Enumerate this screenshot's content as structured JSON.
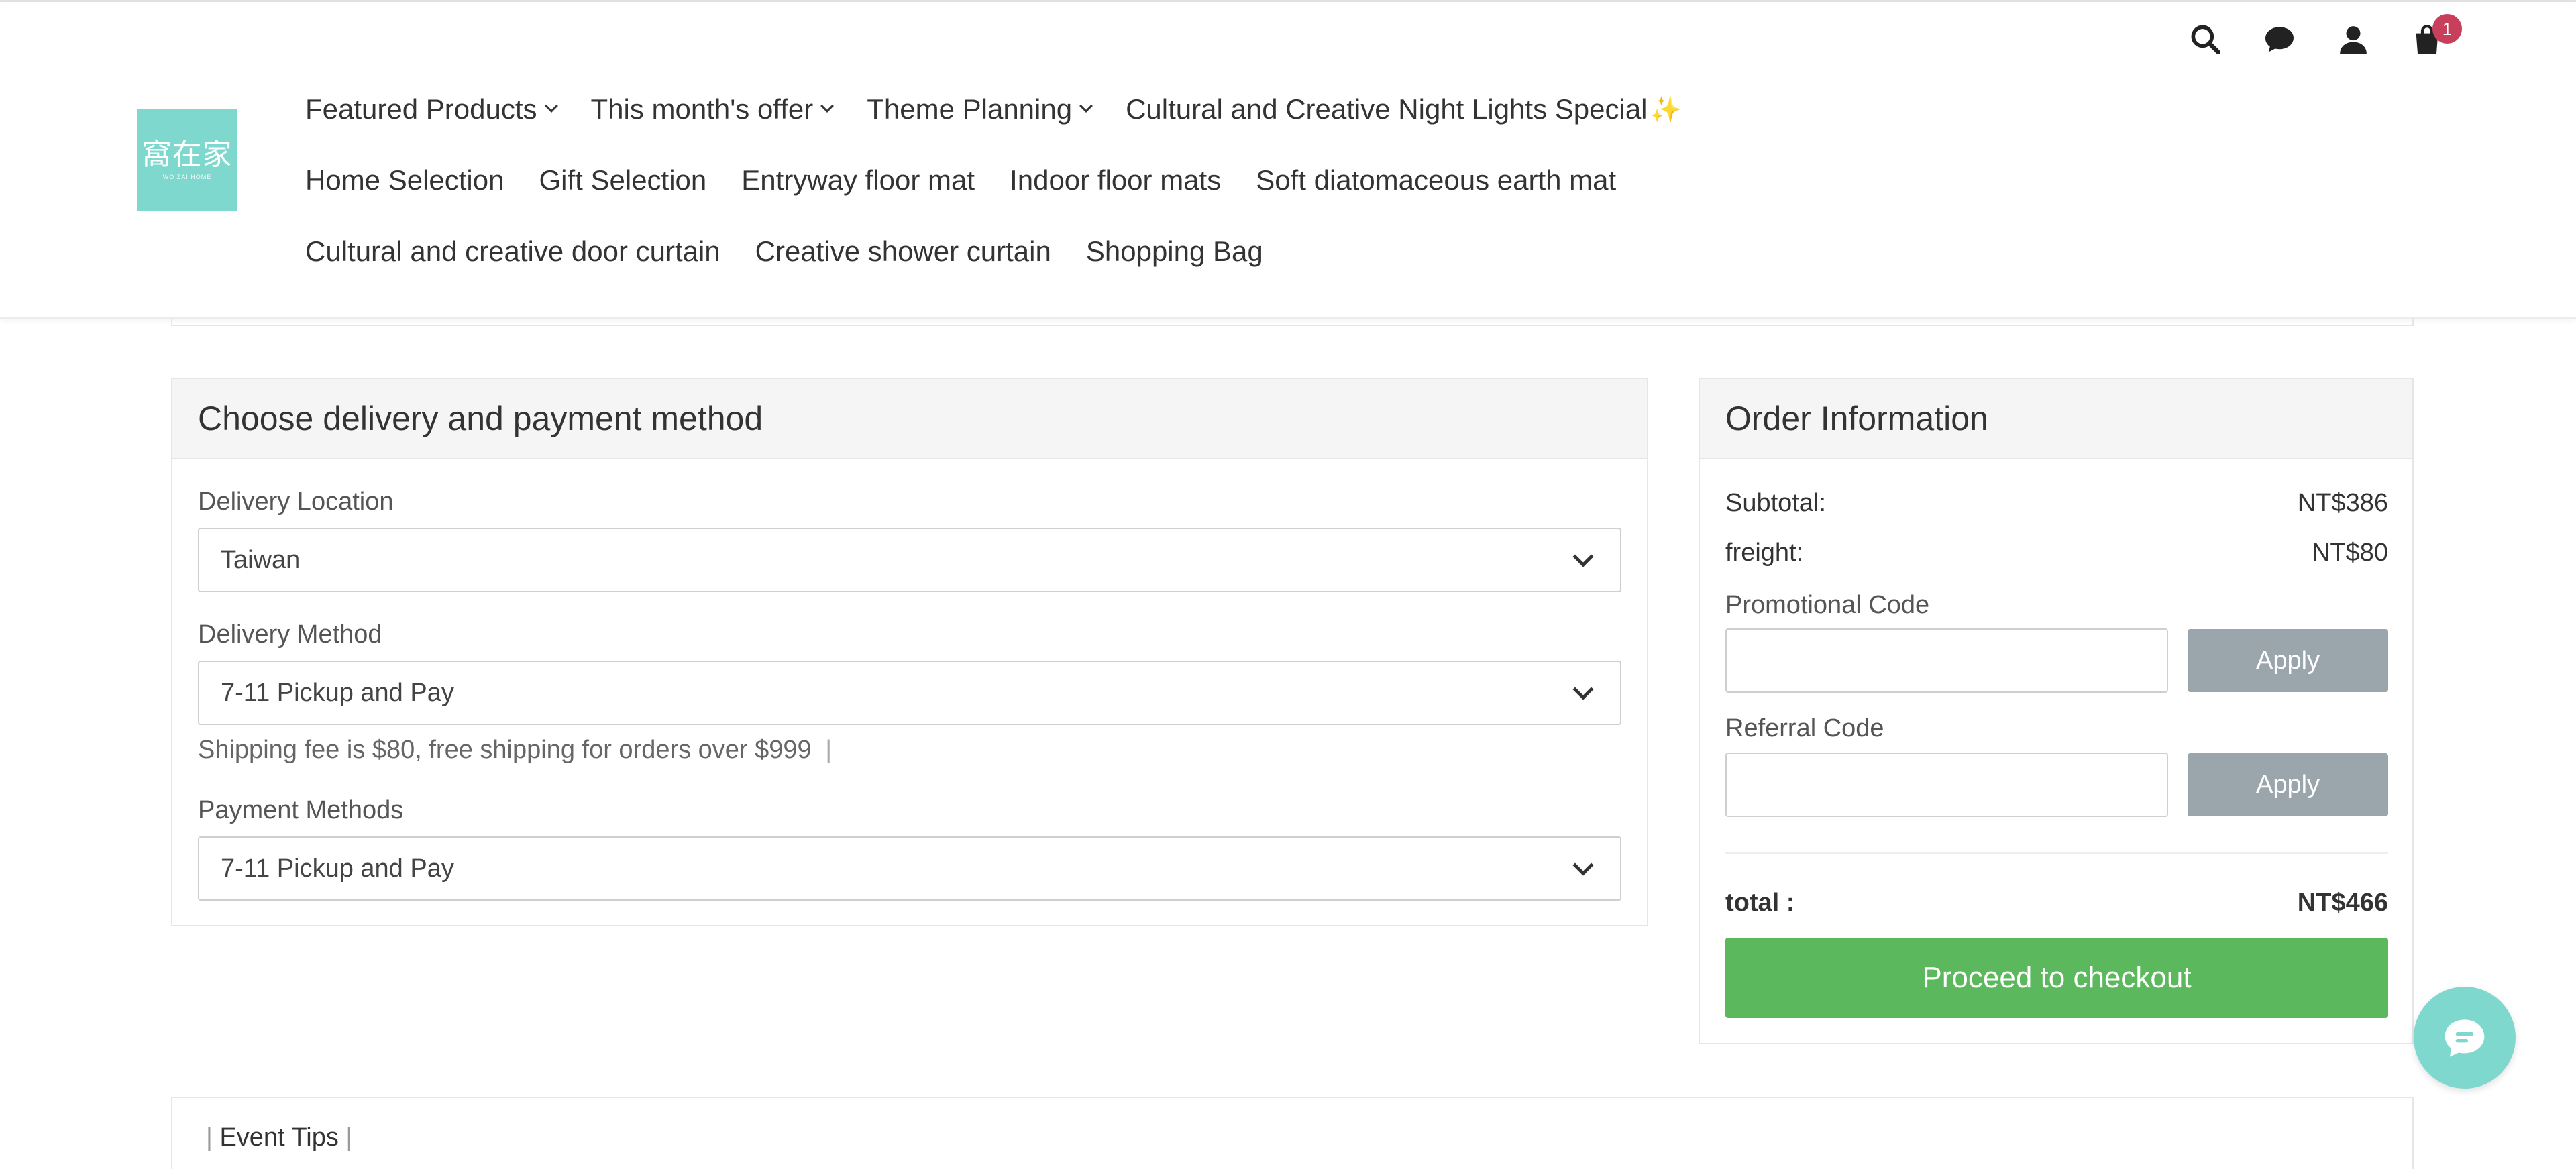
{
  "header": {
    "logo_text": "窩在家",
    "logo_subtext": "WO ZAI HOME",
    "nav_rows": [
      [
        {
          "label": "Featured Products",
          "dropdown": true
        },
        {
          "label": "This month's offer",
          "dropdown": true
        },
        {
          "label": "Theme Planning",
          "dropdown": true
        },
        {
          "label": "Cultural and Creative Night Lights Special",
          "dropdown": false,
          "suffix": "✨"
        }
      ],
      [
        {
          "label": "Home Selection"
        },
        {
          "label": "Gift Selection"
        },
        {
          "label": "Entryway floor mat"
        },
        {
          "label": "Indoor floor mats"
        },
        {
          "label": "Soft diatomaceous earth mat"
        }
      ],
      [
        {
          "label": "Cultural and creative door curtain"
        },
        {
          "label": "Creative shower curtain"
        },
        {
          "label": "Shopping Bag"
        }
      ]
    ],
    "icons": [
      "search-icon",
      "chat-bubble-icon",
      "user-icon",
      "shopping-bag-icon"
    ],
    "cart_count": "1"
  },
  "delivery": {
    "title": "Choose delivery and payment method",
    "location_label": "Delivery Location",
    "location_value": "Taiwan",
    "method_label": "Delivery Method",
    "method_value": "7-11 Pickup and Pay",
    "shipping_note": "Shipping fee is $80, free shipping for orders over $999",
    "shipping_note_bar": "|",
    "payment_label": "Payment Methods",
    "payment_value": "7-11 Pickup and Pay"
  },
  "order": {
    "title": "Order Information",
    "subtotal_label": "Subtotal:",
    "subtotal_value": "NT$386",
    "freight_label": "freight:",
    "freight_value": "NT$80",
    "promo_label": "Promotional Code",
    "promo_apply": "Apply",
    "referral_label": "Referral Code",
    "referral_apply": "Apply",
    "total_label": "total :",
    "total_value": "NT$466",
    "checkout_label": "Proceed to checkout"
  },
  "tips": {
    "bar_left": "|",
    "label": "Event Tips",
    "bar_right": "|"
  },
  "colors": {
    "brand": "#7fd8cd",
    "checkout": "#5cb85c",
    "apply": "#9aa6ab",
    "badge": "#c83f5b"
  }
}
